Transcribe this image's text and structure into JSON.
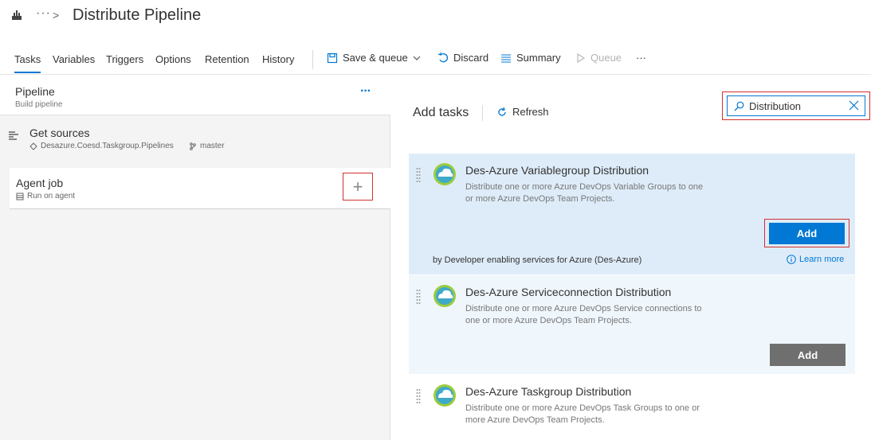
{
  "header": {
    "breadcrumb_dots": "···",
    "breadcrumb_chevron": ">",
    "title": "Distribute Pipeline"
  },
  "tabs": [
    {
      "label": "Tasks",
      "active": true
    },
    {
      "label": "Variables"
    },
    {
      "label": "Triggers"
    },
    {
      "label": "Options"
    },
    {
      "label": "Retention"
    },
    {
      "label": "History"
    }
  ],
  "toolbar": {
    "save_queue": "Save & queue",
    "discard": "Discard",
    "summary": "Summary",
    "queue": "Queue",
    "more": "···"
  },
  "pipeline": {
    "title": "Pipeline",
    "subtitle": "Build pipeline",
    "more": "···"
  },
  "sources": {
    "title": "Get sources",
    "repo": "Desazure.Coesd.Taskgroup.Pipelines",
    "branch": "master"
  },
  "agent_job": {
    "title": "Agent job",
    "subtitle": "Run on agent",
    "plus": "+"
  },
  "add_tasks": {
    "title": "Add tasks",
    "refresh": "Refresh",
    "search_value": "Distribution"
  },
  "tasks": [
    {
      "title": "Des-Azure Variablegroup Distribution",
      "description": "Distribute one or more Azure DevOps Variable Groups to one or more Azure DevOps Team Projects.",
      "add_label": "Add",
      "by": "by Developer enabling services for Azure (Des-Azure)",
      "learn_more": "Learn more"
    },
    {
      "title": "Des-Azure Serviceconnection Distribution",
      "description": "Distribute one or more Azure DevOps Service connections to one or more Azure DevOps Team Projects.",
      "add_label": "Add"
    },
    {
      "title": "Des-Azure Taskgroup Distribution",
      "description": "Distribute one or more Azure DevOps Task Groups to one or more Azure DevOps Team Projects."
    }
  ],
  "colors": {
    "accent": "#0078d4",
    "highlight_border": "#d32f2f",
    "selected_task_bg": "#deecf9"
  }
}
